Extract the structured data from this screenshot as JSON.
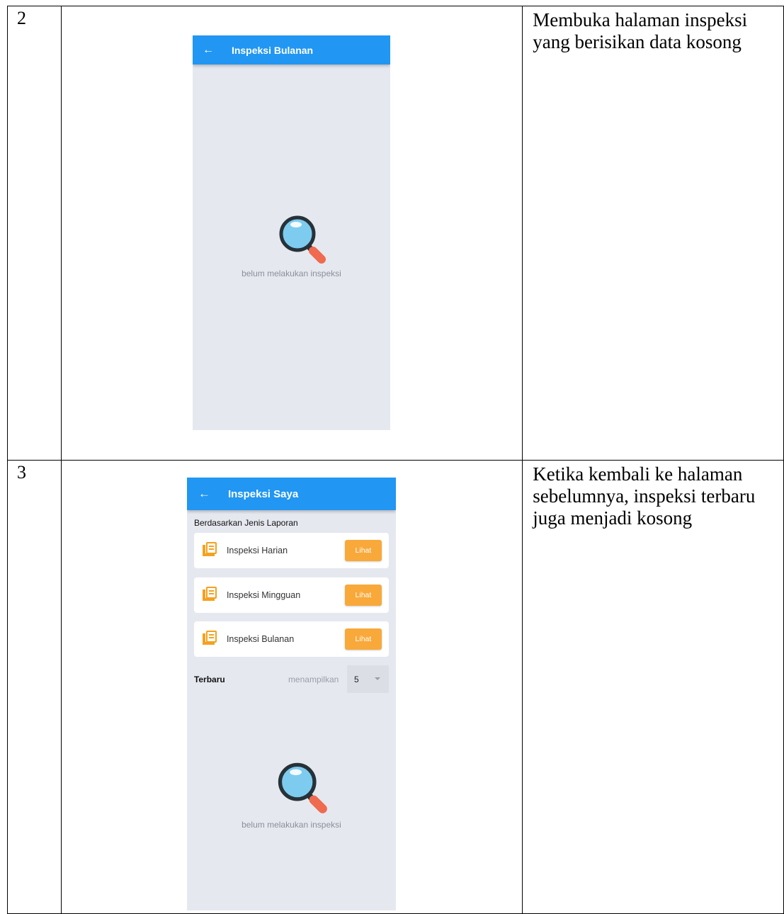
{
  "rows": [
    {
      "number": "2",
      "description": "Membuka halaman inspeksi yang berisikan data kosong",
      "screen": {
        "back_glyph": "←",
        "title": "Inspeksi Bulanan",
        "empty_icon": "magnifier-icon",
        "empty_message": "belum melakukan inspeksi"
      }
    },
    {
      "number": "3",
      "description": "Ketika kembali ke halaman sebelumnya, inspeksi terbaru juga menjadi kosong",
      "screen": {
        "back_glyph": "←",
        "title": "Inspeksi Saya",
        "section_label": "Berdasarkan Jenis Laporan",
        "cards": [
          {
            "label": "Inspeksi Harian",
            "button": "Lihat",
            "icon": "report-icon"
          },
          {
            "label": "Inspeksi Mingguan",
            "button": "Lihat",
            "icon": "report-icon"
          },
          {
            "label": "Inspeksi Bulanan",
            "button": "Lihat",
            "icon": "report-icon"
          }
        ],
        "latest_label": "Terbaru",
        "showing_label": "menampilkan",
        "count_value": "5",
        "empty_icon": "magnifier-icon",
        "empty_message": "belum melakukan inspeksi"
      }
    }
  ],
  "colors": {
    "appbar": "#2196f3",
    "screen_bg": "#e6e8f0",
    "button": "#f8a93a",
    "icon_orange": "#f5a11e",
    "magnifier_lens": "#7ecbf0",
    "magnifier_ring": "#263238",
    "magnifier_handle": "#ef6a4f"
  }
}
